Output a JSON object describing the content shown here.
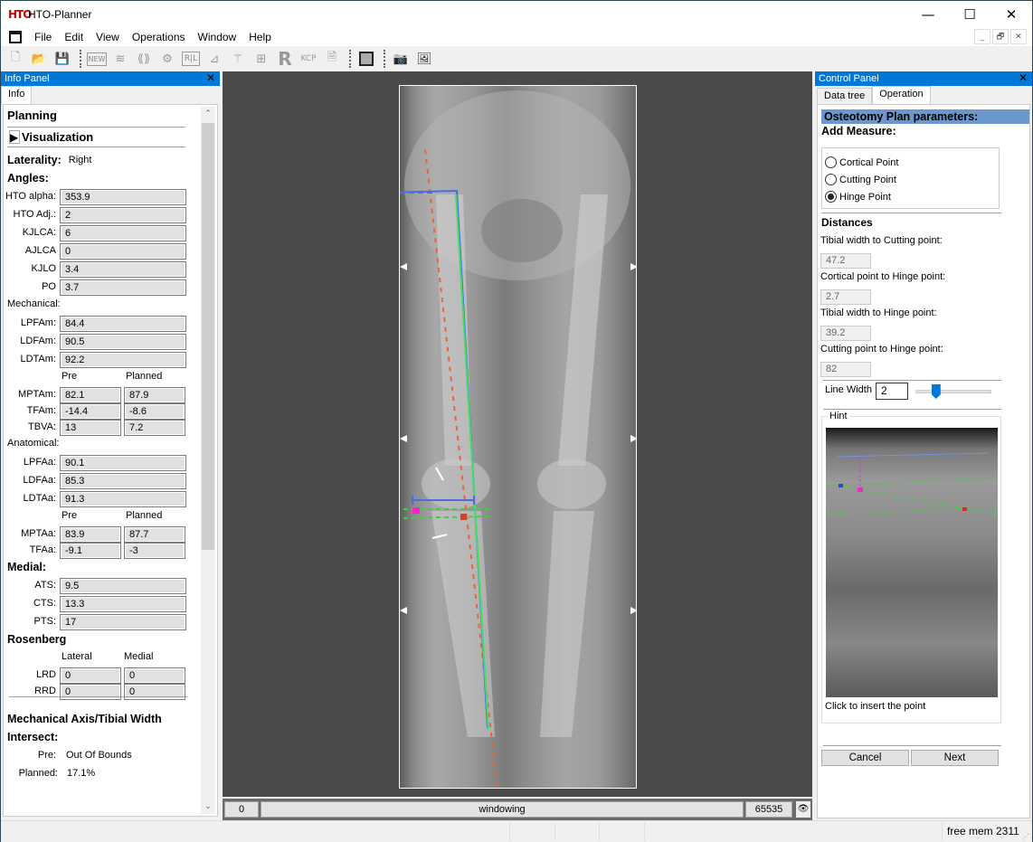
{
  "window": {
    "title": "HTO-Planner",
    "logo_text": "HTO",
    "minimize_glyph": "—",
    "maximize_glyph": "☐",
    "close_glyph": "✕"
  },
  "menu": {
    "items": [
      "File",
      "Edit",
      "View",
      "Operations",
      "Window",
      "Help"
    ],
    "mdi_buttons": [
      "_",
      "🗗",
      "✕"
    ]
  },
  "toolbar": {
    "buttons": [
      {
        "name": "new-file",
        "glyph": "🗋"
      },
      {
        "name": "open",
        "glyph": "📂"
      },
      {
        "name": "save",
        "glyph": "💾"
      },
      {
        "name": "new-plan",
        "glyph": "NEW"
      },
      {
        "name": "layers",
        "glyph": "≋"
      },
      {
        "name": "waves",
        "glyph": "⟪⟫"
      },
      {
        "name": "spine",
        "glyph": "⚙"
      },
      {
        "name": "rl-marker",
        "glyph": "R|L"
      },
      {
        "name": "ruler-angle",
        "glyph": "⊿"
      },
      {
        "name": "axis-tool",
        "glyph": "⚚"
      },
      {
        "name": "grid-tool",
        "glyph": "⊞"
      },
      {
        "name": "r-tool",
        "glyph": "R"
      },
      {
        "name": "kcp-tool",
        "glyph": "KCP"
      },
      {
        "name": "report",
        "glyph": "🗎"
      },
      {
        "name": "fill-square",
        "glyph": ""
      },
      {
        "name": "camera",
        "glyph": "📷"
      },
      {
        "name": "image",
        "glyph": "🖼"
      }
    ]
  },
  "info_panel": {
    "title": "Info Panel",
    "tab": "Info",
    "planning": "Planning",
    "visualization": "Visualization",
    "laterality_label": "Laterality:",
    "laterality_value": "Right",
    "angles_label": "Angles:",
    "angles": [
      {
        "label": "HTO alpha:",
        "value": "353.9"
      },
      {
        "label": "HTO Adj.:",
        "value": "2"
      },
      {
        "label": "KJLCA:",
        "value": "6"
      },
      {
        "label": "AJLCA",
        "value": "0"
      },
      {
        "label": "KJLO",
        "value": "3.4"
      },
      {
        "label": "PO",
        "value": "3.7"
      }
    ],
    "mechanical_label": "Mechanical:",
    "mechanical": [
      {
        "label": "LPFAm:",
        "value": "84.4"
      },
      {
        "label": "LDFAm:",
        "value": "90.5"
      },
      {
        "label": "LDTAm:",
        "value": "92.2"
      }
    ],
    "pre_label": "Pre",
    "planned_label": "Planned",
    "mechanical_pp": [
      {
        "label": "MPTAm:",
        "pre": "82.1",
        "planned": "87.9"
      },
      {
        "label": "TFAm:",
        "pre": "-14.4",
        "planned": "-8.6"
      },
      {
        "label": "TBVA:",
        "pre": "13",
        "planned": "7.2"
      }
    ],
    "anatomical_label": "Anatomical:",
    "anatomical": [
      {
        "label": "LPFAa:",
        "value": "90.1"
      },
      {
        "label": "LDFAa:",
        "value": "85.3"
      },
      {
        "label": "LDTAa:",
        "value": "91.3"
      }
    ],
    "anatomical_pp": [
      {
        "label": "MPTAa:",
        "pre": "83.9",
        "planned": "87.7"
      },
      {
        "label": "TFAa:",
        "pre": "-9.1",
        "planned": "-3"
      }
    ],
    "medial_label": "Medial:",
    "medial": [
      {
        "label": "ATS:",
        "value": "9.5"
      },
      {
        "label": "CTS:",
        "value": "13.3"
      },
      {
        "label": "PTS:",
        "value": "17"
      }
    ],
    "rosenberg_label": "Rosenberg",
    "lateral_label": "Lateral",
    "medial_col_label": "Medial",
    "rosenberg": [
      {
        "label": "LRD",
        "lateral": "0",
        "medial": "0"
      },
      {
        "label": "RRD",
        "lateral": "0",
        "medial": "0"
      }
    ],
    "mech_axis_label": "Mechanical Axis/Tibial Width",
    "intersect_label": "Intersect:",
    "intersect_pre_label": "Pre:",
    "intersect_pre_value": "Out Of Bounds",
    "intersect_planned_label": "Planned:",
    "intersect_planned_value": "17.1%"
  },
  "viewport": {
    "window_min": "0",
    "window_label": "windowing",
    "window_max": "65535",
    "overlay_colors": {
      "mechanical_axis": "#4a6ee0",
      "planned_axis": "#44dd66",
      "anatomical_axis": "#e8643c",
      "osteotomy": "#44cc44",
      "hinge": "#ff22cc",
      "cutting": "#cc4433"
    }
  },
  "control_panel": {
    "title": "Control Panel",
    "tabs": [
      "Data tree",
      "Operation"
    ],
    "active_tab": "Operation",
    "section_title": "Osteotomy Plan parameters:",
    "add_measure": "Add Measure:",
    "radios": [
      {
        "label": "Cortical Point",
        "checked": false
      },
      {
        "label": "Cutting Point",
        "checked": false
      },
      {
        "label": "Hinge Point",
        "checked": true
      }
    ],
    "distances_label": "Distances",
    "distances": [
      {
        "label": "Tibial width to Cutting point:",
        "value": "47.2"
      },
      {
        "label": "Cortical point to Hinge point:",
        "value": "2.7"
      },
      {
        "label": "Tibial width to Hinge point:",
        "value": "39.2"
      },
      {
        "label": "Cutting point to Hinge point:",
        "value": "82"
      }
    ],
    "line_width_label": "Line Width",
    "line_width_value": "2",
    "line_width_slider_fraction": 0.2,
    "hint_label": "Hint",
    "hint_caption": "Click to insert the point",
    "cancel_label": "Cancel",
    "next_label": "Next"
  },
  "statusbar": {
    "free_mem": "free mem 2311"
  }
}
